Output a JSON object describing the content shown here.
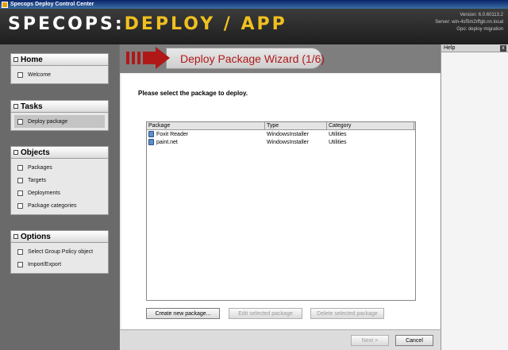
{
  "window": {
    "title": "Specops Deploy Control Center"
  },
  "banner": {
    "logo_left": "SPECOPS:",
    "logo_right": "DEPLOY / APP",
    "version": "Version:  6.0.60113.2",
    "server": "Server:  win-4sf5m2rffgb.nn.local",
    "gpo": "Gpo:  deploy migration"
  },
  "sidebar": {
    "home": {
      "title": "Home",
      "items": [
        {
          "label": "Welcome"
        }
      ]
    },
    "tasks": {
      "title": "Tasks",
      "items": [
        {
          "label": "Deploy package",
          "selected": true
        }
      ]
    },
    "objects": {
      "title": "Objects",
      "items": [
        {
          "label": "Packages"
        },
        {
          "label": "Targets"
        },
        {
          "label": "Deployments"
        },
        {
          "label": "Package categories"
        }
      ]
    },
    "options": {
      "title": "Options",
      "items": [
        {
          "label": "Select Group Policy object"
        },
        {
          "label": "Import/Export"
        }
      ]
    }
  },
  "wizard": {
    "title": "Deploy Package Wizard (1/6)",
    "prompt": "Please select the package to deploy.",
    "columns": [
      "Package",
      "Type",
      "Category"
    ],
    "rows": [
      {
        "package": "Foxit Reader",
        "type": "WindowsInstaller",
        "category": "Utilities"
      },
      {
        "package": "paint.net",
        "type": "WindowsInstaller",
        "category": "Utilities"
      }
    ],
    "buttons": {
      "create": "Create new package...",
      "edit": "Edit selected package",
      "delete": "Delete selected package",
      "next": "Next >",
      "cancel": "Cancel"
    }
  },
  "help": {
    "title": "Help",
    "close": "x"
  },
  "colors": {
    "accent_red": "#b01818",
    "logo_yellow": "#f0c020"
  }
}
